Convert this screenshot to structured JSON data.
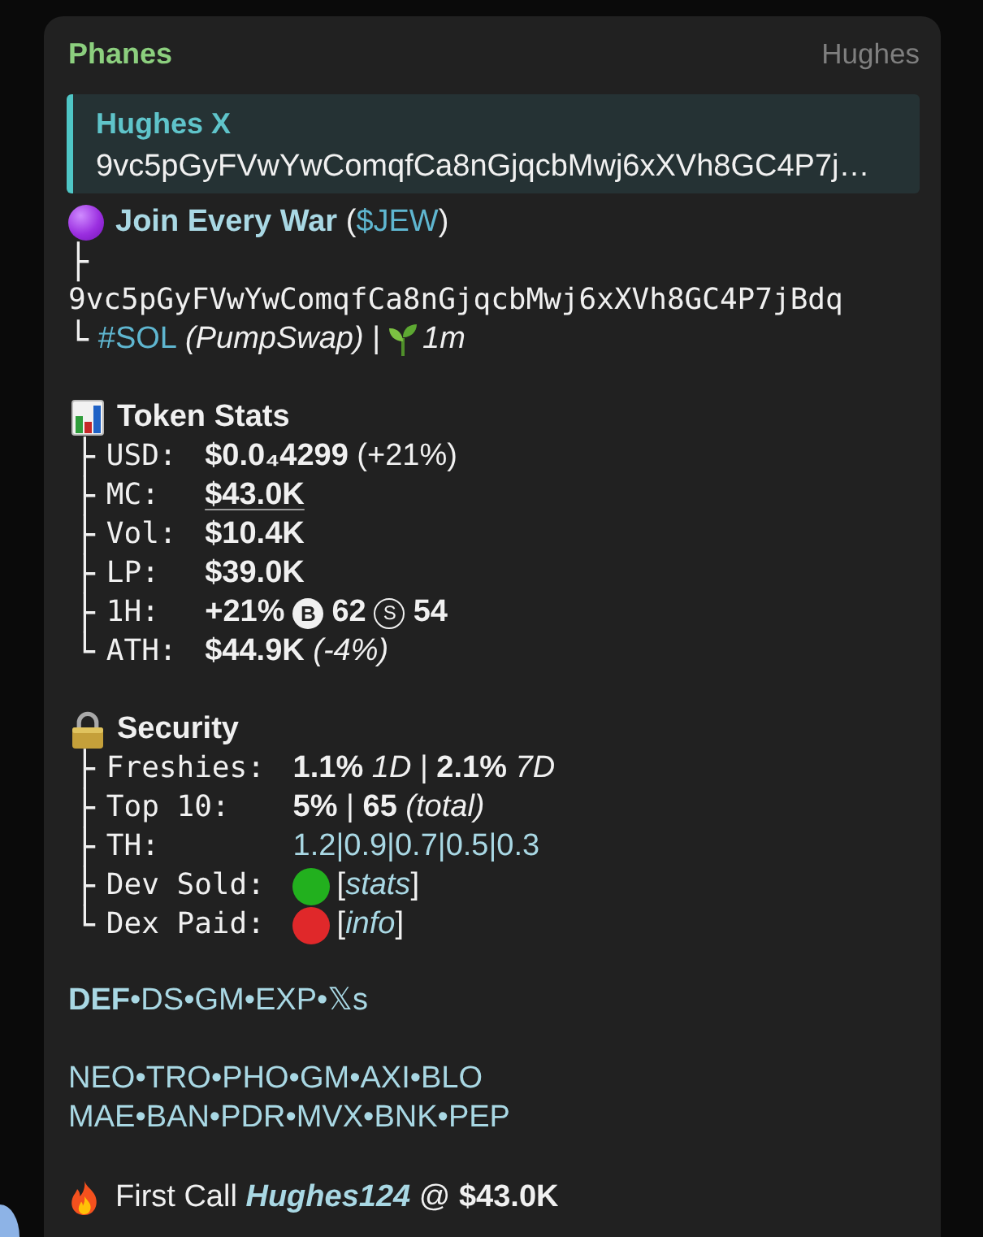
{
  "message": {
    "sender": "Phanes",
    "sender_title": "Hughes",
    "reply": {
      "author": "Hughes X",
      "text": "9vc5pGyFVwYwComqfCa8nGjqcbMwj6xXVh8GC4P7j…"
    },
    "token_line": [
      {
        "kind": "link",
        "text": "Join Every War"
      },
      {
        "kind": "text",
        "text": " ("
      },
      {
        "kind": "tag",
        "text": "$JEW"
      },
      {
        "kind": "text",
        "text": ")"
      }
    ],
    "address": {
      "branch": "├",
      "text": "9vc5pGyFVwYwComqfCa8nGjqcbMwj6xXVh8GC4P7jBdq"
    },
    "chain": {
      "branch": "└",
      "tag": "#SOL",
      "text": "*(PumpSwap)* |",
      "age": "1m"
    },
    "stats": {
      "title": "Token Stats",
      "rows": [
        {
          "branch": "├",
          "label": "USD:",
          "kind": "text",
          "value": "**$0.0₄4299** (+21%)"
        },
        {
          "branch": "├",
          "label": "MC:",
          "kind": "underlined",
          "value": "$43.0K"
        },
        {
          "branch": "├",
          "label": "Vol:",
          "kind": "bold",
          "value": "$10.4K"
        },
        {
          "branch": "├",
          "label": "LP:",
          "kind": "bold",
          "value": "$39.0K"
        },
        {
          "branch": "├",
          "label": "1H:",
          "kind": "trades",
          "change": "+21%",
          "buy_mark": "B",
          "buys": "62",
          "sell_mark": "S",
          "sells": "54"
        },
        {
          "branch": "└",
          "label": "ATH:",
          "kind": "text",
          "value": "**$44.9K** *(-4%)*"
        }
      ]
    },
    "security": {
      "title": "Security",
      "rows": [
        {
          "branch": "├",
          "label": "Freshies:",
          "kind": "text",
          "value": "**1.1%** *1D* | **2.1%** *7D*"
        },
        {
          "branch": "├",
          "label": "Top 10:",
          "kind": "text",
          "value": "**5%** | **65** *(total)*"
        },
        {
          "branch": "├",
          "label": "TH:",
          "kind": "link",
          "value": "1.2|0.9|0.7|0.5|0.3"
        },
        {
          "branch": "├",
          "label": "Dev Sold:",
          "kind": "status",
          "color": "#22b01e",
          "open": "[",
          "link": "stats",
          "close": "]"
        },
        {
          "branch": "└",
          "label": "Dex Paid:",
          "kind": "status",
          "color": "#e0282a",
          "open": "[",
          "link": "info",
          "close": "]"
        }
      ]
    },
    "link_groups": [
      [
        [
          {
            "text": "DEF",
            "bold": true,
            "sep": "•"
          },
          {
            "text": "DS",
            "bold": false,
            "sep": "•"
          },
          {
            "text": "GM",
            "bold": false,
            "sep": "•"
          },
          {
            "text": "EXP",
            "bold": false,
            "sep": "•"
          },
          {
            "text": "𝕏s",
            "bold": false
          }
        ]
      ],
      [
        [
          {
            "text": "NEO",
            "bold": false,
            "sep": "•"
          },
          {
            "text": "TRO",
            "bold": false,
            "sep": "•"
          },
          {
            "text": "PHO",
            "bold": false,
            "sep": "•"
          },
          {
            "text": "GM",
            "bold": false,
            "sep": "•"
          },
          {
            "text": "AXI",
            "bold": false,
            "sep": "•"
          },
          {
            "text": "BLO",
            "bold": false
          }
        ],
        [
          {
            "text": "MAE",
            "bold": false,
            "sep": "•"
          },
          {
            "text": "BAN",
            "bold": false,
            "sep": "•"
          },
          {
            "text": "PDR",
            "bold": false,
            "sep": "•"
          },
          {
            "text": "MVX",
            "bold": false,
            "sep": "•"
          },
          {
            "text": "BNK",
            "bold": false,
            "sep": "•"
          },
          {
            "text": "PEP",
            "bold": false
          }
        ]
      ]
    ],
    "first_call": [
      {
        "kind": "text",
        "text": "First Call "
      },
      {
        "kind": "link",
        "text": "Hughes124"
      },
      {
        "kind": "text",
        "text": " @ **$43.0K**"
      }
    ]
  }
}
